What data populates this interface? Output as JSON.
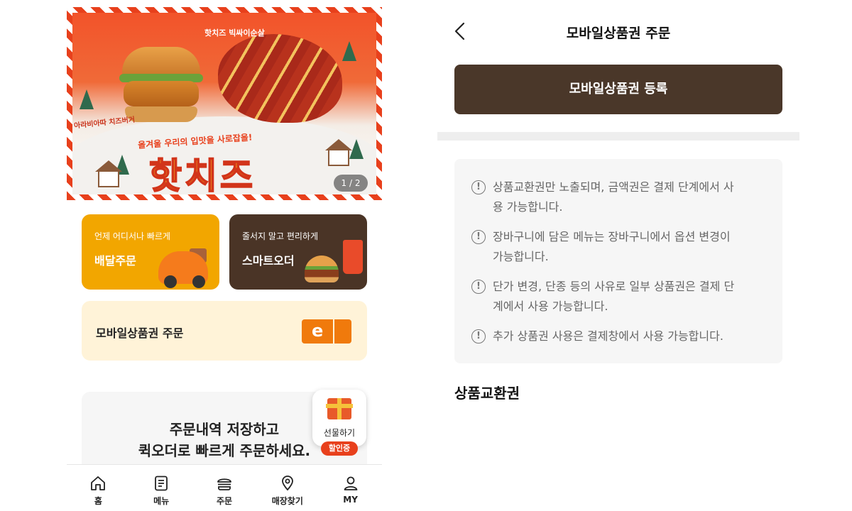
{
  "left": {
    "banner": {
      "headline": "핫치즈",
      "subline": "올겨울 우리의 입맛을 사로잡을!",
      "product1": "핫치즈 빅싸이순살",
      "product2": "아라비아따 치즈버거",
      "pager": "1 / 2"
    },
    "delivery": {
      "small": "언제 어디서나 빠르게",
      "title": "배달주문"
    },
    "smart": {
      "small": "줄서지 말고 편리하게",
      "title": "스마트오더"
    },
    "mobile_card": {
      "title": "모바일상품권 주문",
      "icon_letter": "e"
    },
    "promo": {
      "line1": "주문내역 저장하고",
      "line2": "퀵오더로 빠르게 주문하세요."
    },
    "gift": {
      "label": "선물하기",
      "badge": "할인중"
    },
    "tabs": [
      {
        "label": "홈",
        "icon": "home-icon"
      },
      {
        "label": "메뉴",
        "icon": "menu-icon"
      },
      {
        "label": "주문",
        "icon": "burger-icon"
      },
      {
        "label": "매장찾기",
        "icon": "location-pin-icon"
      },
      {
        "label": "MY",
        "icon": "user-icon"
      }
    ]
  },
  "right": {
    "title": "모바일상품권 주문",
    "register_button": "모바일상품권 등록",
    "notices": [
      {
        "line1": "상품교환권만 노출되며, 금액권은 결제 단계에서 사",
        "line2": "용 가능합니다."
      },
      {
        "line1": "장바구니에 담은 메뉴는 장바구니에서 옵션 변경이",
        "line2": "가능합니다."
      },
      {
        "line1": "단가 변경, 단종 등의 사유로 일부 상품권은 결제 단",
        "line2": "계에서 사용 가능합니다."
      },
      {
        "line1": "추가 상품권 사용은 결제창에서 사용 가능합니다.",
        "line2": ""
      }
    ],
    "section_title": "상품교환권"
  },
  "colors": {
    "brand_red": "#e8401c",
    "delivery_yellow": "#f2a600",
    "dark_brown": "#4a3729",
    "cream": "#fff3d8"
  }
}
